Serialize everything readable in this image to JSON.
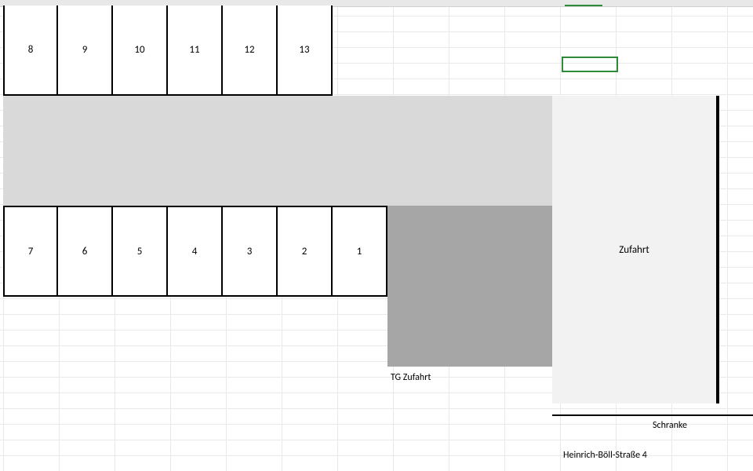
{
  "slots_top": [
    "8",
    "9",
    "10",
    "11",
    "12",
    "13"
  ],
  "slots_bottom": [
    "7",
    "6",
    "5",
    "4",
    "3",
    "2",
    "1"
  ],
  "labels": {
    "zufahrt": "Zufahrt",
    "tg_zufahrt": "TG Zufahrt",
    "schranke": "Schranke",
    "street": "Heinrich-Böll-Straße 4"
  }
}
